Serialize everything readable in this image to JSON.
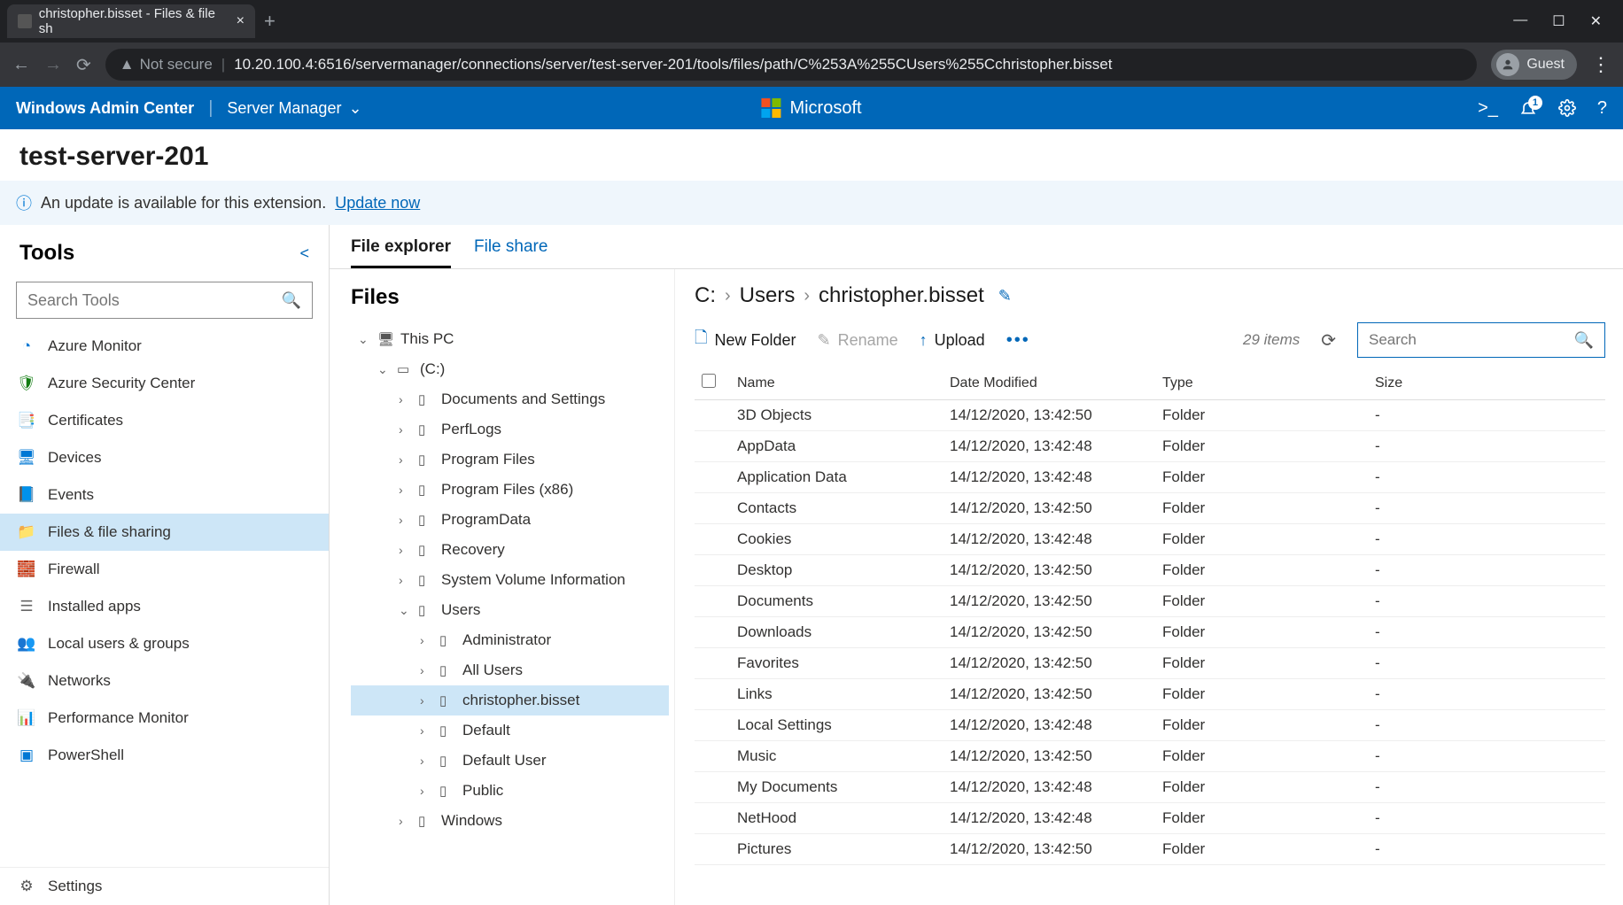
{
  "browser": {
    "tab_title": "christopher.bisset - Files & file sh",
    "not_secure": "Not secure",
    "url": "10.20.100.4:6516/servermanager/connections/server/test-server-201/tools/files/path/C%253A%255CUsers%255Cchristopher.bisset",
    "guest": "Guest"
  },
  "header": {
    "brand": "Windows Admin Center",
    "context": "Server Manager",
    "ms": "Microsoft",
    "notif_badge": "1"
  },
  "page_title": "test-server-201",
  "banner": {
    "text": "An update is available for this extension.",
    "link": "Update now"
  },
  "tools": {
    "title": "Tools",
    "search_placeholder": "Search Tools",
    "items": [
      {
        "label": "Azure Monitor",
        "color": "#0078d4",
        "glyph": "◔"
      },
      {
        "label": "Azure Security Center",
        "color": "#107c10",
        "glyph": "🛡"
      },
      {
        "label": "Certificates",
        "color": "#d83b01",
        "glyph": "📑"
      },
      {
        "label": "Devices",
        "color": "#0078d4",
        "glyph": "🖥"
      },
      {
        "label": "Events",
        "color": "#0078d4",
        "glyph": "📘"
      },
      {
        "label": "Files & file sharing",
        "color": "#ffb900",
        "glyph": "📁",
        "active": true
      },
      {
        "label": "Firewall",
        "color": "#d13438",
        "glyph": "🧱"
      },
      {
        "label": "Installed apps",
        "color": "#666",
        "glyph": "☰"
      },
      {
        "label": "Local users & groups",
        "color": "#0078d4",
        "glyph": "👥"
      },
      {
        "label": "Networks",
        "color": "#881798",
        "glyph": "🔌"
      },
      {
        "label": "Performance Monitor",
        "color": "#0078d4",
        "glyph": "📊"
      },
      {
        "label": "PowerShell",
        "color": "#0078d4",
        "glyph": "▣"
      }
    ],
    "settings": "Settings"
  },
  "subtabs": {
    "file_explorer": "File explorer",
    "file_share": "File share"
  },
  "tree": {
    "title": "Files",
    "root": "This PC",
    "drive": "(C:)",
    "folders": [
      "Documents and Settings",
      "PerfLogs",
      "Program Files",
      "Program Files (x86)",
      "ProgramData",
      "Recovery",
      "System Volume Information"
    ],
    "users": "Users",
    "user_children": [
      "Administrator",
      "All Users",
      "christopher.bisset",
      "Default",
      "Default User",
      "Public"
    ],
    "windows": "Windows"
  },
  "breadcrumb": [
    "C:",
    "Users",
    "christopher.bisset"
  ],
  "toolbar": {
    "new_folder": "New Folder",
    "rename": "Rename",
    "upload": "Upload",
    "item_count": "29 items",
    "search_placeholder": "Search"
  },
  "columns": {
    "name": "Name",
    "date": "Date Modified",
    "type": "Type",
    "size": "Size"
  },
  "rows": [
    {
      "name": "3D Objects",
      "date": "14/12/2020, 13:42:50",
      "type": "Folder",
      "size": "-"
    },
    {
      "name": "AppData",
      "date": "14/12/2020, 13:42:48",
      "type": "Folder",
      "size": "-"
    },
    {
      "name": "Application Data",
      "date": "14/12/2020, 13:42:48",
      "type": "Folder",
      "size": "-"
    },
    {
      "name": "Contacts",
      "date": "14/12/2020, 13:42:50",
      "type": "Folder",
      "size": "-"
    },
    {
      "name": "Cookies",
      "date": "14/12/2020, 13:42:48",
      "type": "Folder",
      "size": "-"
    },
    {
      "name": "Desktop",
      "date": "14/12/2020, 13:42:50",
      "type": "Folder",
      "size": "-"
    },
    {
      "name": "Documents",
      "date": "14/12/2020, 13:42:50",
      "type": "Folder",
      "size": "-"
    },
    {
      "name": "Downloads",
      "date": "14/12/2020, 13:42:50",
      "type": "Folder",
      "size": "-"
    },
    {
      "name": "Favorites",
      "date": "14/12/2020, 13:42:50",
      "type": "Folder",
      "size": "-"
    },
    {
      "name": "Links",
      "date": "14/12/2020, 13:42:50",
      "type": "Folder",
      "size": "-"
    },
    {
      "name": "Local Settings",
      "date": "14/12/2020, 13:42:48",
      "type": "Folder",
      "size": "-"
    },
    {
      "name": "Music",
      "date": "14/12/2020, 13:42:50",
      "type": "Folder",
      "size": "-"
    },
    {
      "name": "My Documents",
      "date": "14/12/2020, 13:42:48",
      "type": "Folder",
      "size": "-"
    },
    {
      "name": "NetHood",
      "date": "14/12/2020, 13:42:48",
      "type": "Folder",
      "size": "-"
    },
    {
      "name": "Pictures",
      "date": "14/12/2020, 13:42:50",
      "type": "Folder",
      "size": "-"
    }
  ]
}
